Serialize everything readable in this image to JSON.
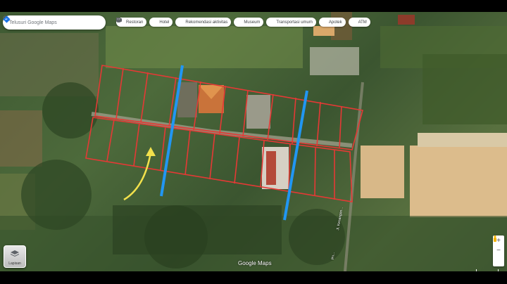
{
  "search": {
    "placeholder": "Telusuri Google Maps",
    "search_icon": "search-icon",
    "directions_icon": "directions-icon"
  },
  "chips": [
    {
      "label": "Restoran",
      "icon": "fork-knife-icon"
    },
    {
      "label": "Hotel",
      "icon": "bed-icon"
    },
    {
      "label": "Rekomendasi aktivitas",
      "icon": "camera-icon"
    },
    {
      "label": "Museum",
      "icon": "museum-icon"
    },
    {
      "label": "Transportasi umum",
      "icon": "bus-icon"
    },
    {
      "label": "Apotek",
      "icon": "pharmacy-icon"
    },
    {
      "label": "ATM",
      "icon": "atm-icon"
    }
  ],
  "layers": {
    "label": "Lapisan"
  },
  "brand": "Google Maps",
  "road_labels": [
    "Jl. Kenangan...",
    "Pn..."
  ],
  "colors": {
    "plot_outline": "#e53935",
    "marker_line": "#2196f3",
    "arrow": "#f2e14c"
  }
}
